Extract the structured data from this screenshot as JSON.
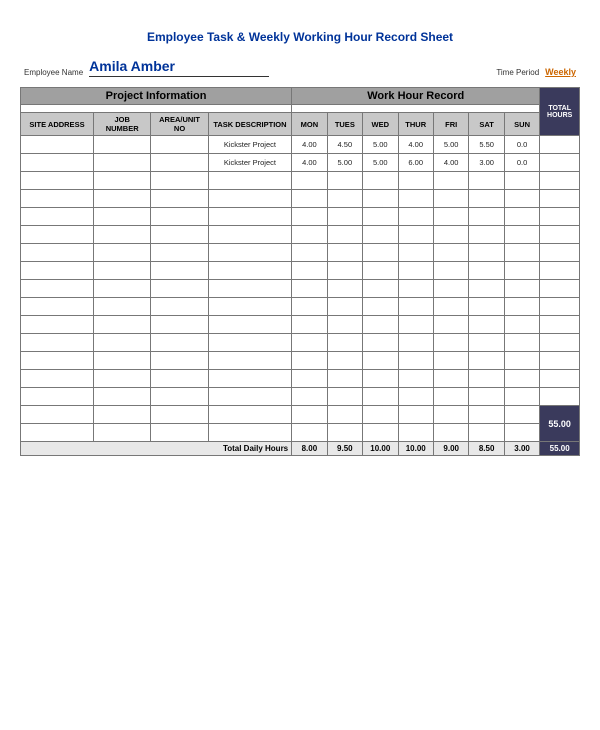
{
  "title": "Employee Task & Weekly Working Hour Record Sheet",
  "employee": {
    "label": "Employee Name",
    "name": "Amila Amber"
  },
  "time_period": {
    "label": "Time Period",
    "value": "Weekly"
  },
  "sections": {
    "project_info": "Project Information",
    "work_hour": "Work Hour Record"
  },
  "columns": {
    "project": [
      "SITE ADDRESS",
      "JOB NUMBER",
      "AREA/UNIT NO",
      "TASK DESCRIPTION"
    ],
    "days": [
      "MON",
      "TUES",
      "WED",
      "THUR",
      "FRI",
      "SAT",
      "SUN"
    ]
  },
  "total_hours_label": "TOTAL HOURS",
  "total_daily_label": "Total Daily Hours",
  "data_rows": [
    {
      "site": "",
      "job": "",
      "area": "",
      "task": "Kickster Project",
      "mon": "4.00",
      "tues": "4.50",
      "wed": "5.00",
      "thur": "4.00",
      "fri": "5.00",
      "sat": "5.50",
      "sun": "0.0"
    },
    {
      "site": "",
      "job": "",
      "area": "",
      "task": "Kickster Project",
      "mon": "4.00",
      "tues": "5.00",
      "wed": "5.00",
      "thur": "6.00",
      "fri": "4.00",
      "sat": "3.00",
      "sun": "0.0"
    }
  ],
  "totals": {
    "mon": "8.00",
    "tues": "9.50",
    "wed": "10.00",
    "thur": "10.00",
    "fri": "9.00",
    "sat": "8.50",
    "sun": "3.00",
    "total": "55.00"
  },
  "num_empty_rows": 13
}
